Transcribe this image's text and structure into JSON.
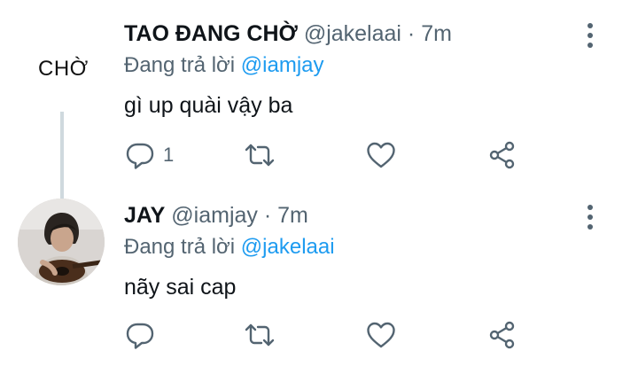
{
  "tweets": [
    {
      "avatar_text": "CHỜ",
      "name": "TAO ĐANG CHỜ",
      "handle": "@jakelaai",
      "separator": "·",
      "time": "7m",
      "replying_prefix": "Đang trả lời",
      "replying_to": "@iamjay",
      "text": "gì up quài vậy ba",
      "reply_count": "1"
    },
    {
      "name": "JAY",
      "handle": "@iamjay",
      "separator": "·",
      "time": "7m",
      "replying_prefix": "Đang trả lời",
      "replying_to": "@jakelaai",
      "text": "nãy sai cap",
      "reply_count": ""
    }
  ],
  "colors": {
    "text": "#0f1419",
    "secondary": "#536471",
    "mention": "#1d9bf0",
    "thread_line": "#cfd9de"
  },
  "icons": [
    "more-vertical-icon",
    "reply-icon",
    "retweet-icon",
    "like-icon",
    "share-icon"
  ]
}
